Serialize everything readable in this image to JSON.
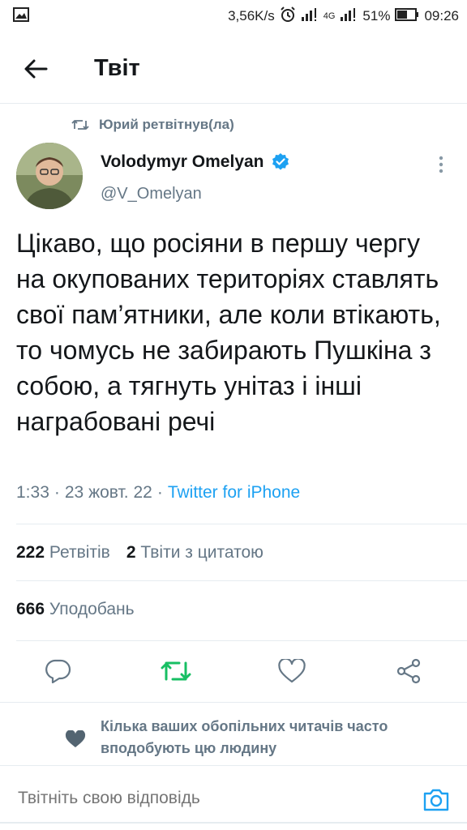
{
  "status_bar": {
    "speed": "3,56K/s",
    "network": "4G",
    "battery": "51%",
    "time": "09:26"
  },
  "header": {
    "title": "Твіт"
  },
  "retweet_context": {
    "label": "Юрий ретвітнув(ла)"
  },
  "author": {
    "name": "Volodymyr Omelyan",
    "handle": "@V_Omelyan",
    "verified": true
  },
  "tweet": {
    "text": "Цікаво, що росіяни в першу чергу на окупованих територіях ставлять свої пам’ятники, але коли втікають, то чомусь не забирають Пушкіна з собою, а тягнуть унітаз і інші награбовані речі",
    "time": "1:33",
    "date": "23 жовт. 22",
    "source": "Twitter for iPhone"
  },
  "stats": {
    "retweets_count": "222",
    "retweets_label": "Ретвітів",
    "quotes_count": "2",
    "quotes_label": "Твіти з цитатою",
    "likes_count": "666",
    "likes_label": "Уподобань"
  },
  "mutuals_notice": {
    "text": "Кілька ваших обопільних читачів часто вподобують цю людину"
  },
  "reply": {
    "placeholder": "Твітніть свою відповідь"
  },
  "colors": {
    "accent": "#1da1f2",
    "retweet_active": "#17bf63",
    "secondary_text": "#657786",
    "divider": "#e6ecf0"
  },
  "icons": [
    "gallery-icon",
    "alarm-icon",
    "signal-icon",
    "battery-icon",
    "back-arrow-icon",
    "retweet-small-icon",
    "verified-badge-icon",
    "more-vertical-icon",
    "reply-icon",
    "retweet-icon",
    "like-icon",
    "share-icon",
    "heart-filled-icon",
    "camera-icon"
  ]
}
